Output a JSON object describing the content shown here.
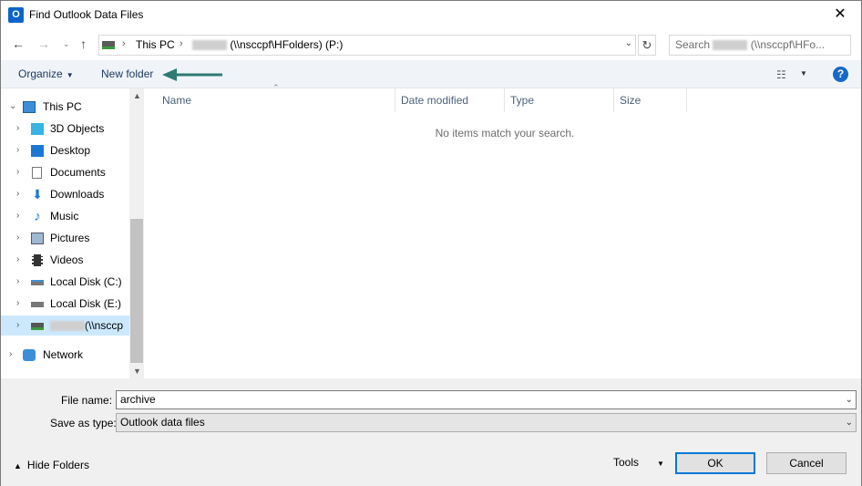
{
  "window": {
    "title": "Find Outlook Data Files",
    "app_icon_text": "O"
  },
  "nav": {
    "back": "←",
    "forward": "→",
    "recent": "⌄",
    "up": "↑",
    "refresh": "↻"
  },
  "address": {
    "crumbs": [
      "This PC",
      "(\\\\nsccpf\\HFolders) (P:)"
    ],
    "separator": "›"
  },
  "search": {
    "placeholder_prefix": "Search",
    "placeholder_suffix": "(\\\\nsccpf\\HFo..."
  },
  "toolbar": {
    "organize_label": "Organize",
    "new_folder_label": "New folder",
    "help_label": "?"
  },
  "sidebar": {
    "items": [
      {
        "label": "This PC",
        "icon": "computer-icon"
      },
      {
        "label": "3D Objects",
        "icon": "cube-icon"
      },
      {
        "label": "Desktop",
        "icon": "desktop-icon"
      },
      {
        "label": "Documents",
        "icon": "document-icon"
      },
      {
        "label": "Downloads",
        "icon": "download-icon"
      },
      {
        "label": "Music",
        "icon": "music-icon"
      },
      {
        "label": "Pictures",
        "icon": "picture-icon"
      },
      {
        "label": "Videos",
        "icon": "video-icon"
      },
      {
        "label": "Local Disk (C:)",
        "icon": "drive-icon"
      },
      {
        "label": "Local Disk (E:)",
        "icon": "drive-icon"
      },
      {
        "label": "(\\\\nsccp",
        "icon": "network-drive-icon",
        "selected": true
      },
      {
        "label": "Network",
        "icon": "network-icon"
      }
    ]
  },
  "columns": {
    "name": "Name",
    "date_modified": "Date modified",
    "type": "Type",
    "size": "Size"
  },
  "main": {
    "empty_message": "No items match your search."
  },
  "form": {
    "file_name_label": "File name:",
    "file_name_value": "archive",
    "save_type_label": "Save as type:",
    "save_type_value": "Outlook data files"
  },
  "footer": {
    "hide_folders_label": "Hide Folders",
    "tools_label": "Tools",
    "ok_label": "OK",
    "cancel_label": "Cancel"
  },
  "colors": {
    "accent": "#0078d7",
    "selected_bg": "#cce8ff",
    "annotation_arrow": "#2f7a73"
  }
}
